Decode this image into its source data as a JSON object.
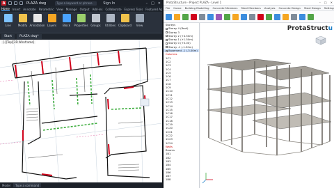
{
  "cad": {
    "app_logo": "A",
    "filename": "PLAZA dwg",
    "search_placeholder": "Type a keyword or phrase",
    "signin": "Sign In",
    "tabs": [
      "Home",
      "Insert",
      "Annotate",
      "Parametric",
      "View",
      "Manage",
      "Output",
      "Add-ins",
      "Collaborate",
      "Express Tools",
      "Featured Apps"
    ],
    "active_tab": "Home",
    "ribbon_tools": [
      {
        "label": "Line",
        "icon": "line-tool-icon",
        "color": "#7ec3ff"
      },
      {
        "label": "Modify",
        "icon": "modify-tool-icon",
        "color": "#f0c24b"
      },
      {
        "label": "Annotation",
        "icon": "annotation-icon",
        "color": "#e8e8e8"
      },
      {
        "label": "Layers",
        "icon": "layers-icon",
        "color": "#f5a623"
      },
      {
        "label": "Block",
        "icon": "block-icon",
        "color": "#4aa3ff"
      },
      {
        "label": "Properties",
        "icon": "properties-icon",
        "color": "#9bd06c"
      },
      {
        "label": "Groups",
        "icon": "groups-icon",
        "color": "#c0c6cf"
      },
      {
        "label": "Utilities",
        "icon": "utilities-icon",
        "color": "#aeb7c4"
      },
      {
        "label": "Clipboard",
        "icon": "clipboard-icon",
        "color": "#f0c24b"
      },
      {
        "label": "View",
        "icon": "view-icon",
        "color": "#9aa6b5"
      }
    ],
    "doc_tabs": [
      "Start",
      "PLAZA dwg*"
    ],
    "view_label": "[-][Top][2D Wireframe]",
    "status": {
      "model": "Model",
      "command_placeholder": "Type a command"
    }
  },
  "pro": {
    "title": "ProtaStructure - Project PLAZA - Level 1",
    "menu": [
      "File",
      "Home",
      "Building Modelling",
      "Concrete Members",
      "Steel Members",
      "Analysis",
      "Concrete Design",
      "Steel Design",
      "Settings",
      "Reports",
      "Help"
    ],
    "ribbon_icon_colors": [
      "#3c8dde",
      "#f5a623",
      "#53a548",
      "#d0021b",
      "#7f8c9a",
      "#3c8dde",
      "#9b59b6",
      "#53a548",
      "#f5a623",
      "#3c8dde",
      "#7f8c9a",
      "#d0021b",
      "#53a548",
      "#3c8dde",
      "#f5a623",
      "#7f8c9a",
      "#3c8dde",
      "#53a548"
    ],
    "tree": [
      {
        "label": "Storeys",
        "type": "plain"
      },
      {
        "label": "Storey 4 (Roof)",
        "type": "check"
      },
      {
        "label": "Storey 3",
        "type": "check"
      },
      {
        "label": "Storey 2 (+4.50m)",
        "type": "check"
      },
      {
        "label": "Storey 1 (+1.50m)",
        "type": "check"
      },
      {
        "label": "Storey 0 (+0.00)",
        "type": "check"
      },
      {
        "label": "Storey -1 (-1.50m)",
        "type": "check"
      },
      {
        "label": "Basement -1 (-3.00m)",
        "type": "sel"
      },
      {
        "label": "Columns",
        "type": "red"
      },
      {
        "label": "1C1",
        "type": "plain"
      },
      {
        "label": "1C2",
        "type": "plain"
      },
      {
        "label": "1C3",
        "type": "plain"
      },
      {
        "label": "1C4",
        "type": "plain"
      },
      {
        "label": "1C5",
        "type": "plain"
      },
      {
        "label": "1C6",
        "type": "plain"
      },
      {
        "label": "1C7",
        "type": "plain"
      },
      {
        "label": "1C8",
        "type": "plain"
      },
      {
        "label": "1C9",
        "type": "plain"
      },
      {
        "label": "1C10",
        "type": "plain"
      },
      {
        "label": "1C11",
        "type": "plain"
      },
      {
        "label": "1C12",
        "type": "plain"
      },
      {
        "label": "1C13",
        "type": "plain"
      },
      {
        "label": "1C14",
        "type": "plain"
      },
      {
        "label": "1C15",
        "type": "plain"
      },
      {
        "label": "1C16",
        "type": "plain"
      },
      {
        "label": "1C17",
        "type": "plain"
      },
      {
        "label": "1C18",
        "type": "plain"
      },
      {
        "label": "1C19",
        "type": "plain"
      },
      {
        "label": "1C20",
        "type": "plain"
      },
      {
        "label": "1C21",
        "type": "plain"
      },
      {
        "label": "1C22",
        "type": "plain"
      },
      {
        "label": "1C23",
        "type": "plain"
      },
      {
        "label": "1C24",
        "type": "plain"
      },
      {
        "label": "Walls",
        "type": "red"
      },
      {
        "label": "Beams",
        "type": "plain"
      },
      {
        "label": "1B1",
        "type": "plain"
      },
      {
        "label": "1B2",
        "type": "plain"
      },
      {
        "label": "1B3",
        "type": "plain"
      },
      {
        "label": "1B4",
        "type": "plain"
      },
      {
        "label": "1B5",
        "type": "plain"
      },
      {
        "label": "1B6",
        "type": "plain"
      },
      {
        "label": "1B7",
        "type": "plain"
      },
      {
        "label": "1B8",
        "type": "plain"
      }
    ],
    "logo_main": "ProtaStruct",
    "logo_accent": "u"
  }
}
